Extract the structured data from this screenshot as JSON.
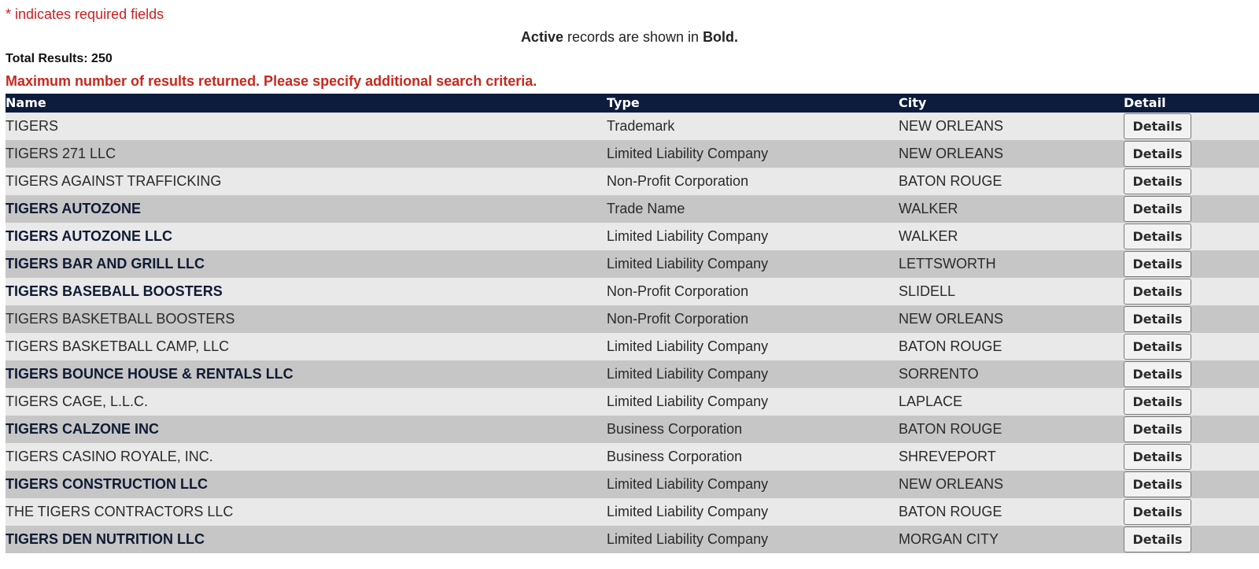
{
  "notes": {
    "required_fields": "* indicates required fields",
    "active_prefix": "Active",
    "active_middle": " records are shown in ",
    "active_suffix": "Bold."
  },
  "summary": {
    "total_results": "Total Results: 250",
    "max_warning": "Maximum number of results returned. Please specify additional search criteria."
  },
  "colors": {
    "header_bg": "#0d1c3d",
    "warning_red": "#c8281e",
    "row_light": "#e9e9e9",
    "row_dark": "#c6c6c6",
    "active_text": "#0f1a33"
  },
  "table": {
    "columns": [
      "Name",
      "Type",
      "City",
      "Detail"
    ],
    "button_label": "Details",
    "rows": [
      {
        "name": "TIGERS",
        "type": "Trademark",
        "city": "NEW ORLEANS",
        "active": false
      },
      {
        "name": "TIGERS 271 LLC",
        "type": "Limited Liability Company",
        "city": "NEW ORLEANS",
        "active": false
      },
      {
        "name": "TIGERS AGAINST TRAFFICKING",
        "type": "Non-Profit Corporation",
        "city": "BATON ROUGE",
        "active": false
      },
      {
        "name": "TIGERS AUTOZONE",
        "type": "Trade Name",
        "city": "WALKER",
        "active": true
      },
      {
        "name": "TIGERS AUTOZONE LLC",
        "type": "Limited Liability Company",
        "city": "WALKER",
        "active": true
      },
      {
        "name": "TIGERS BAR AND GRILL LLC",
        "type": "Limited Liability Company",
        "city": "LETTSWORTH",
        "active": true
      },
      {
        "name": "TIGERS BASEBALL BOOSTERS",
        "type": "Non-Profit Corporation",
        "city": "SLIDELL",
        "active": true
      },
      {
        "name": "TIGERS BASKETBALL BOOSTERS",
        "type": "Non-Profit Corporation",
        "city": "NEW ORLEANS",
        "active": false
      },
      {
        "name": "TIGERS BASKETBALL CAMP, LLC",
        "type": "Limited Liability Company",
        "city": "BATON ROUGE",
        "active": false
      },
      {
        "name": "TIGERS BOUNCE HOUSE & RENTALS LLC",
        "type": "Limited Liability Company",
        "city": "SORRENTO",
        "active": true
      },
      {
        "name": "TIGERS CAGE, L.L.C.",
        "type": "Limited Liability Company",
        "city": "LAPLACE",
        "active": false
      },
      {
        "name": "TIGERS CALZONE INC",
        "type": "Business Corporation",
        "city": "BATON ROUGE",
        "active": true
      },
      {
        "name": "TIGERS CASINO ROYALE, INC.",
        "type": "Business Corporation",
        "city": "SHREVEPORT",
        "active": false
      },
      {
        "name": "TIGERS CONSTRUCTION LLC",
        "type": "Limited Liability Company",
        "city": "NEW ORLEANS",
        "active": true
      },
      {
        "name": "THE TIGERS CONTRACTORS LLC",
        "type": "Limited Liability Company",
        "city": "BATON ROUGE",
        "active": false
      },
      {
        "name": "TIGERS DEN NUTRITION LLC",
        "type": "Limited Liability Company",
        "city": "MORGAN CITY",
        "active": true
      }
    ]
  }
}
